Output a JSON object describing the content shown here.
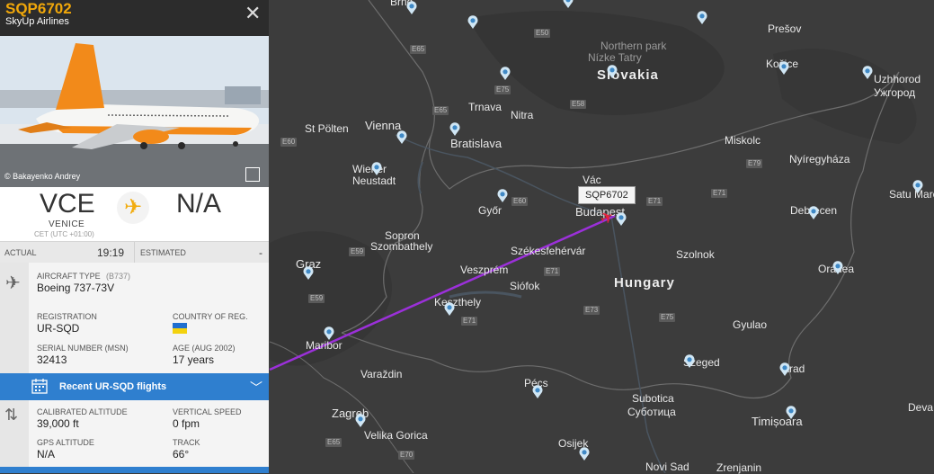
{
  "flight": {
    "callsign": "SQP6702",
    "airline": "SkyUp Airlines",
    "photo_credit": "© Bakayenko Andrey",
    "origin": {
      "code": "VCE",
      "city": "VENICE",
      "timezone": "CET (UTC +01:00)"
    },
    "destination": {
      "code": "N/A"
    },
    "actual_label": "ACTUAL",
    "actual_time": "19:19",
    "estimated_label": "ESTIMATED",
    "estimated_value": "-"
  },
  "aircraft": {
    "type_label": "AIRCRAFT TYPE",
    "type_code": "(B737)",
    "type_value": "Boeing 737-73V",
    "registration_label": "REGISTRATION",
    "registration_value": "UR-SQD",
    "country_label": "COUNTRY OF REG.",
    "serial_label": "SERIAL NUMBER (MSN)",
    "serial_value": "32413",
    "age_label": "AGE (AUG 2002)",
    "age_value": "17 years"
  },
  "recent": {
    "label": "Recent UR-SQD flights"
  },
  "telemetry": {
    "cal_alt_label": "CALIBRATED ALTITUDE",
    "cal_alt_value": "39,000 ft",
    "vs_label": "VERTICAL SPEED",
    "vs_value": "0 fpm",
    "gps_label": "GPS ALTITUDE",
    "gps_value": "N/A",
    "track_label": "TRACK",
    "track_value": "66°"
  },
  "map": {
    "flight_tag": "SQP6702",
    "cities": [
      "Brno",
      "Prešov",
      "Northern park",
      "Nízke Tatry",
      "Slovakia",
      "Košice",
      "Uzhhorod",
      "Ужгород",
      "Trnava",
      "Nitra",
      "Vienna",
      "St Pölten",
      "Bratislava",
      "Miskolc",
      "Wiener Neustadt",
      "Nyíregyháza",
      "Vác",
      "Győr",
      "Satu Mare",
      "Budapest",
      "Debrecen",
      "Sopron",
      "Szombathely",
      "Székesfehérvár",
      "Szolnok",
      "Graz",
      "Veszprém",
      "Oradea",
      "Siófok",
      "Hungary",
      "Keszthely",
      "Maribor",
      "Gyulao",
      "Varaždin",
      "Szeged",
      "Arad",
      "Pécs",
      "Subotica",
      "Суботица",
      "Zagreb",
      "Timișoara",
      "Deva",
      "Velika Gorica",
      "Osijek",
      "Novi Sad",
      "Zrenjanin"
    ],
    "roads": [
      "E65",
      "E50",
      "E75",
      "E58",
      "E65",
      "E60",
      "E79",
      "E60",
      "E71",
      "E71",
      "E59",
      "E71",
      "E59",
      "E73",
      "E71",
      "E75",
      "E65",
      "E70"
    ]
  },
  "colors": {
    "accent": "#f0a70a",
    "route": "#9b30d9",
    "recent_bar": "#2f7fcf",
    "plane": "#e8223c"
  }
}
